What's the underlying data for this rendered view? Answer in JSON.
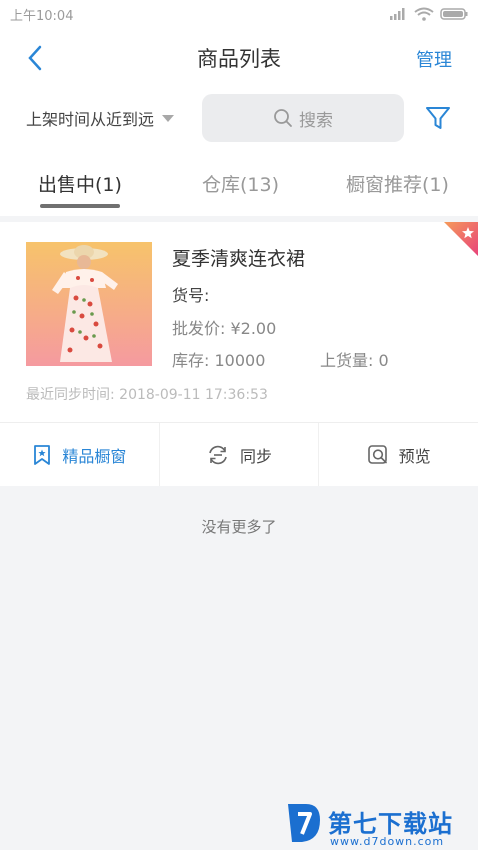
{
  "status_bar": {
    "time": "上午10:04"
  },
  "header": {
    "title": "商品列表",
    "manage_label": "管理"
  },
  "filter": {
    "sort_label": "上架时间从近到远",
    "search_placeholder": "搜索"
  },
  "tabs": [
    {
      "label": "出售中(1)",
      "active": true
    },
    {
      "label": "仓库(13)",
      "active": false
    },
    {
      "label": "橱窗推荐(1)",
      "active": false
    }
  ],
  "product": {
    "name": "夏季清爽连衣裙",
    "sku": "货号:",
    "price": "批发价: ¥2.00",
    "stock": "库存: 10000",
    "listed": "上货量: 0",
    "sync_time": "最近同步时间: 2018-09-11 17:36:53"
  },
  "actions": [
    {
      "label": "精品橱窗",
      "icon": "bookmark-star-icon"
    },
    {
      "label": "同步",
      "icon": "sync-icon"
    },
    {
      "label": "预览",
      "icon": "preview-icon"
    }
  ],
  "footer": {
    "no_more": "没有更多了"
  },
  "watermark": {
    "brand": "第七下载站",
    "url": "www.d7down.com"
  },
  "colors": {
    "accent": "#2a86d6",
    "background": "#f3f4f6",
    "badge": "#ec5f6c"
  }
}
